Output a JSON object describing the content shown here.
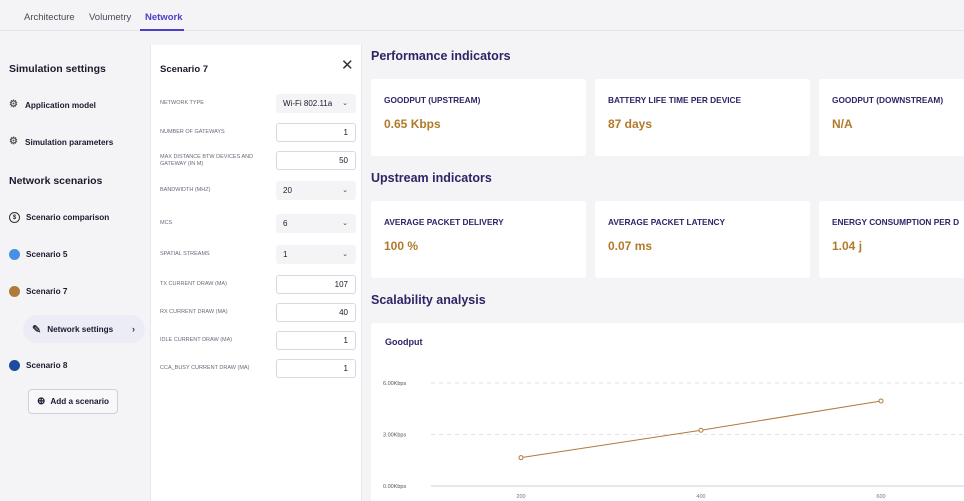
{
  "tabs": [
    {
      "label": "Architecture"
    },
    {
      "label": "Volumetry"
    },
    {
      "label": "Network"
    }
  ],
  "sidebar": {
    "simulation_title": "Simulation settings",
    "application_model": "Application model",
    "simulation_parameters": "Simulation parameters",
    "network_title": "Network scenarios",
    "scenario_comparison": "Scenario comparison",
    "scenarios": [
      {
        "label": "Scenario 5",
        "color": "#4a90e2"
      },
      {
        "label": "Scenario 7",
        "color": "#b07a3a"
      },
      {
        "label": "Scenario 8",
        "color": "#1f4aa0"
      }
    ],
    "network_settings": "Network settings",
    "add_scenario": "Add a scenario"
  },
  "panel": {
    "title": "Scenario 7",
    "fields": [
      {
        "label": "NETWORK TYPE",
        "value": "Wi-Fi 802.11a",
        "kind": "select"
      },
      {
        "label": "NUMBER OF GATEWAYS",
        "value": "1",
        "kind": "input"
      },
      {
        "label": "MAX DISTANCE BTW DEVICES AND GATEWAY (IN M)",
        "value": "50",
        "kind": "input"
      },
      {
        "label": "BANDWIDTH (MHZ)",
        "value": "20",
        "kind": "select"
      },
      {
        "label": "MCS",
        "value": "6",
        "kind": "select"
      },
      {
        "label": "SPATIAL STREAMS",
        "value": "1",
        "kind": "select"
      },
      {
        "label": "TX CURRENT DRAW (MA)",
        "value": "107",
        "kind": "input"
      },
      {
        "label": "RX CURRENT DRAW (MA)",
        "value": "40",
        "kind": "input"
      },
      {
        "label": "IDLE CURRENT DRAW (MA)",
        "value": "1",
        "kind": "input"
      },
      {
        "label": "CCA_BUSY CURRENT DRAW (MA)",
        "value": "1",
        "kind": "input"
      }
    ]
  },
  "performance": {
    "title": "Performance indicators",
    "cards": [
      {
        "label": "GOODPUT (UPSTREAM)",
        "value": "0.65 Kbps"
      },
      {
        "label": "BATTERY LIFE TIME PER DEVICE",
        "value": "87 days"
      },
      {
        "label": "GOODPUT (DOWNSTREAM)",
        "value": "N/A"
      }
    ]
  },
  "upstream": {
    "title": "Upstream indicators",
    "cards": [
      {
        "label": "AVERAGE PACKET DELIVERY",
        "value": "100 %"
      },
      {
        "label": "AVERAGE PACKET LATENCY",
        "value": "0.07 ms"
      },
      {
        "label": "ENERGY CONSUMPTION PER D",
        "value": "1.04 j"
      }
    ]
  },
  "scalability": {
    "title": "Scalability analysis"
  },
  "chart_data": {
    "type": "line",
    "title": "Goodput",
    "x": [
      200,
      400,
      600
    ],
    "x_tick_labels": [
      "200",
      "400",
      "600"
    ],
    "y_tick_labels": [
      "0.00Kbps",
      "3.00Kbps",
      "6.00Kbps"
    ],
    "y_ticks": [
      0,
      3,
      6
    ],
    "ylim": [
      0,
      6
    ],
    "xlim": [
      100,
      700
    ],
    "series": [
      {
        "values": [
          1.65,
          3.25,
          4.95
        ],
        "color": "#b07a3a"
      }
    ],
    "grid": true
  }
}
